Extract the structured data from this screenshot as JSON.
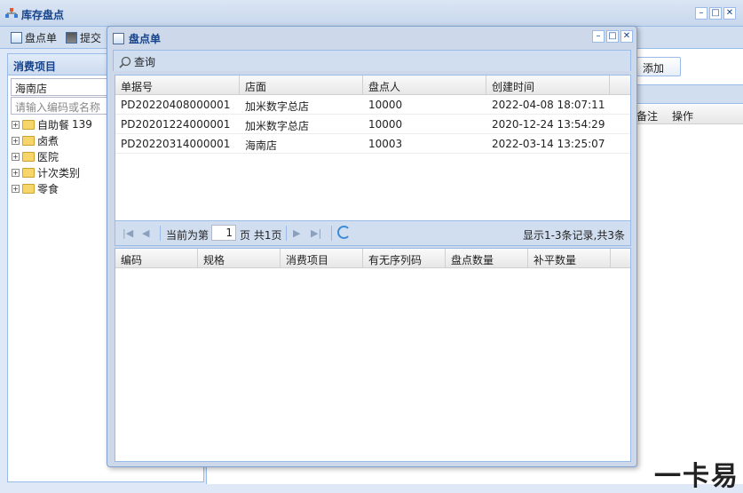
{
  "window": {
    "title": "库存盘点",
    "min": "–",
    "max": "□",
    "close": "✕"
  },
  "outer_toolbar": {
    "btn_inventory": "盘点单",
    "btn_submit": "提交"
  },
  "left": {
    "header": "消费项目",
    "store_value": "海南店",
    "search_placeholder": "请输入编码或名称",
    "tree": [
      {
        "label": "自助餐",
        "count": "139"
      },
      {
        "label": "卤煮",
        "count": ""
      },
      {
        "label": "医院",
        "count": ""
      },
      {
        "label": "计次类别",
        "count": ""
      },
      {
        "label": "零食",
        "count": ""
      }
    ]
  },
  "right": {
    "add_label": "添加",
    "col_remark": "备注",
    "col_action": "操作"
  },
  "dialog": {
    "title": "盘点单",
    "query_label": "查询",
    "grid1": {
      "headers": [
        "单据号",
        "店面",
        "盘点人",
        "创建时间"
      ],
      "rows": [
        [
          "PD20220408000001",
          "加米数字总店",
          "10000",
          "2022-04-08 18:07:11"
        ],
        [
          "PD20201224000001",
          "加米数字总店",
          "10000",
          "2020-12-24 13:54:29"
        ],
        [
          "PD20220314000001",
          "海南店",
          "10003",
          "2022-03-14 13:25:07"
        ]
      ]
    },
    "pager": {
      "before": "当前为第",
      "page": "1",
      "after": "页 共1页",
      "summary": "显示1-3条记录,共3条"
    },
    "grid2": {
      "headers": [
        "编码",
        "规格",
        "消费项目",
        "有无序列码",
        "盘点数量",
        "补平数量"
      ]
    }
  },
  "watermark": "一卡易"
}
